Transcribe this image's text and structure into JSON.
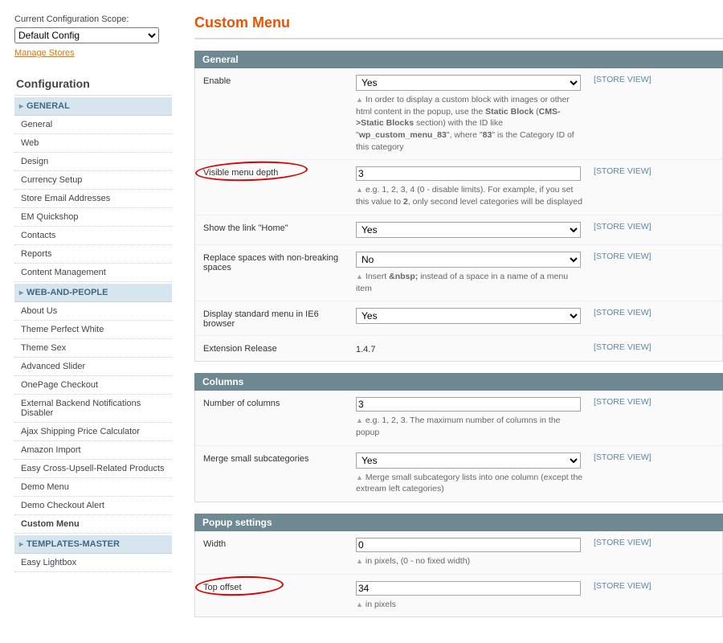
{
  "scope": {
    "label": "Current Configuration Scope:",
    "value": "Default Config",
    "manage_stores": "Manage Stores"
  },
  "config_heading": "Configuration",
  "nav": {
    "groups": [
      {
        "title": "GENERAL",
        "items": [
          "General",
          "Web",
          "Design",
          "Currency Setup",
          "Store Email Addresses",
          "EM Quickshop",
          "Contacts",
          "Reports",
          "Content Management"
        ]
      },
      {
        "title": "WEB-AND-PEOPLE",
        "items": [
          "About Us",
          "Theme Perfect White",
          "Theme Sex",
          "Advanced Slider",
          "OnePage Checkout",
          "External Backend Notifications Disabler",
          "Ajax Shipping Price Calculator",
          "Amazon Import",
          "Easy Cross-Upsell-Related Products",
          "Demo Menu",
          "Demo Checkout Alert",
          "Custom Menu"
        ],
        "active_index": 11
      },
      {
        "title": "TEMPLATES-MASTER",
        "items": [
          "Easy Lightbox"
        ]
      }
    ]
  },
  "page_title": "Custom Menu",
  "scope_tag": "[STORE VIEW]",
  "sections": {
    "general": {
      "title": "General",
      "enable": {
        "label": "Enable",
        "value": "Yes",
        "hint_pre": "In order to display a custom block with images or other html content in the popup, use the ",
        "hint_b1": "Static Block",
        "hint_mid": " (",
        "hint_b2": "CMS->Static Blocks",
        "hint_mid2": " section) with the ID like \"",
        "hint_b3": "wp_custom_menu_83",
        "hint_mid3": "\", where \"",
        "hint_b4": "83",
        "hint_end": "\" is the Category ID of this category"
      },
      "depth": {
        "label": "Visible menu depth",
        "value": "3",
        "hint_pre": "e.g. 1, 2, 3, 4 (0 - disable limits). For example, if you set this value to ",
        "hint_b1": "2",
        "hint_end": ", only second level categories will be displayed"
      },
      "home": {
        "label": "Show the link \"Home\"",
        "value": "Yes"
      },
      "nbsp": {
        "label": "Replace spaces with non-breaking spaces",
        "value": "No",
        "hint_pre": "Insert ",
        "hint_b1": "&nbsp;",
        "hint_end": " instead of a space in a name of a menu item"
      },
      "ie6": {
        "label": "Display standard menu in IE6 browser",
        "value": "Yes"
      },
      "release": {
        "label": "Extension Release",
        "value": "1.4.7"
      }
    },
    "columns": {
      "title": "Columns",
      "num": {
        "label": "Number of columns",
        "value": "3",
        "hint": "e.g. 1, 2, 3. The maximum number of columns in the popup"
      },
      "merge": {
        "label": "Merge small subcategories",
        "value": "Yes",
        "hint": "Merge small subcategory lists into one column (except the extream left categories)"
      }
    },
    "popup": {
      "title": "Popup settings",
      "width": {
        "label": "Width",
        "value": "0",
        "hint": "in pixels, (0 - no fixed width)"
      },
      "top": {
        "label": "Top offset",
        "value": "34",
        "hint": "in pixels"
      }
    }
  }
}
